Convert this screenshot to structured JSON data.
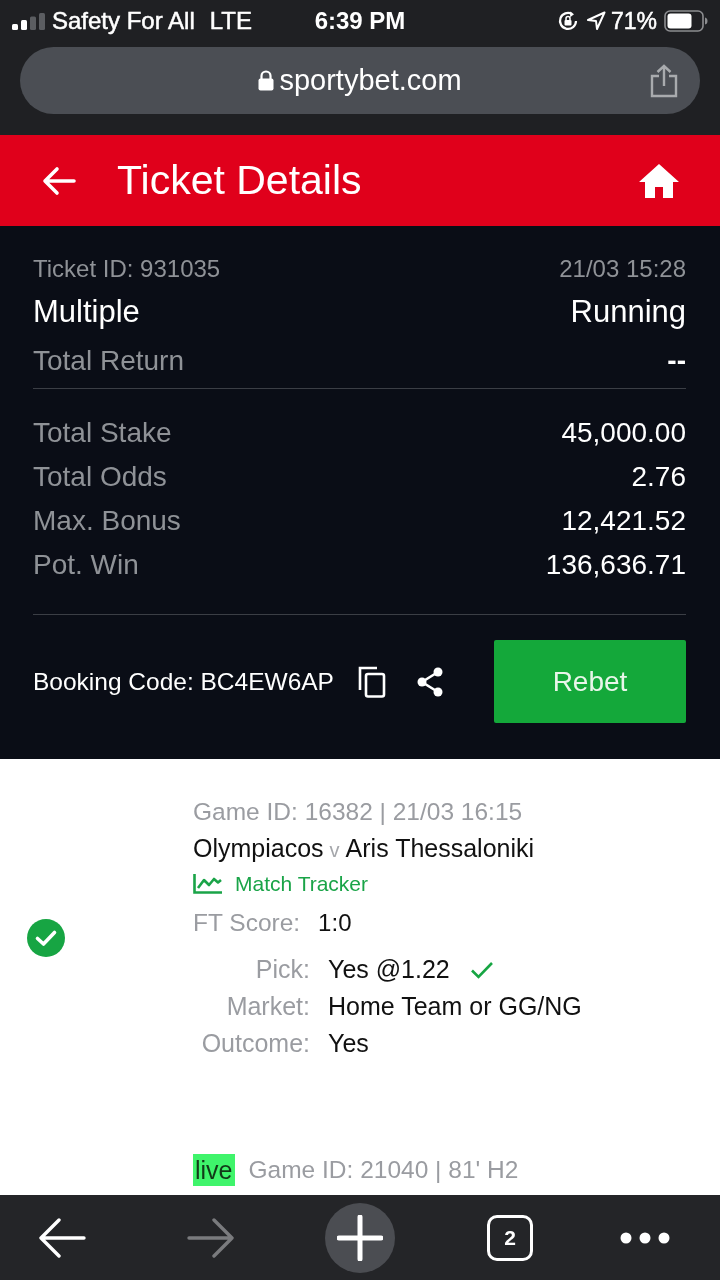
{
  "status_bar": {
    "carrier": "Safety For All",
    "network": "LTE",
    "time": "6:39 PM",
    "battery": "71%"
  },
  "browser": {
    "url": "sportybet.com"
  },
  "header": {
    "title": "Ticket Details"
  },
  "ticket": {
    "id": "Ticket ID: 931035",
    "date": "21/03 15:28",
    "bet_type": "Multiple",
    "status": "Running",
    "total_return": {
      "label": "Total Return",
      "value": "--"
    },
    "stats": [
      {
        "label": "Total Stake",
        "value": "45,000.00"
      },
      {
        "label": "Total Odds",
        "value": "2.76"
      },
      {
        "label": "Max. Bonus",
        "value": "12,421.52"
      },
      {
        "label": "Pot. Win",
        "value": "136,636.71"
      }
    ],
    "booking_code": "Booking Code: BC4EW6AP",
    "rebet": "Rebet"
  },
  "selections": [
    {
      "live": false,
      "won": true,
      "game": "Game ID: 16382 | 21/03 16:15",
      "home": "Olympiacos",
      "vs": "v",
      "away": "Aris Thessaloniki",
      "tracker": "Match Tracker",
      "score": {
        "label": "FT Score:",
        "value": "1:0"
      },
      "details": [
        {
          "label": "Pick:",
          "value": "Yes @1.22",
          "correct": true
        },
        {
          "label": "Market:",
          "value": "Home Team or GG/NG",
          "correct": false
        },
        {
          "label": "Outcome:",
          "value": "Yes",
          "correct": false
        }
      ]
    },
    {
      "live": true,
      "live_label": "live",
      "game": "Game ID: 21040 | 81' H2"
    }
  ],
  "toolbar": {
    "forward_enabled": false,
    "tab_count": "2"
  }
}
